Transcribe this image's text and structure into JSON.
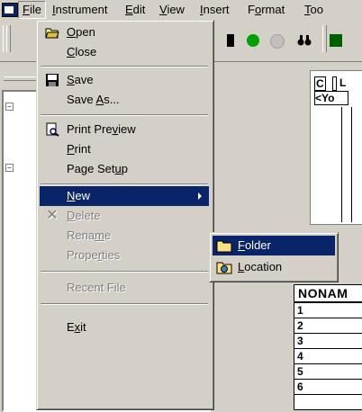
{
  "menubar": {
    "items": [
      {
        "label": "File",
        "key": "F",
        "rest": "ile"
      },
      {
        "label": "Instrument",
        "key": "I",
        "rest": "nstrument"
      },
      {
        "label": "Edit",
        "key": "E",
        "rest": "dit"
      },
      {
        "label": "View",
        "key": "V",
        "rest": "iew"
      },
      {
        "label": "Insert",
        "key": "I",
        "rest": "nsert"
      },
      {
        "label": "Format",
        "pre": "F",
        "key": "o",
        "rest": "rmat"
      },
      {
        "label": "Too",
        "key": "T",
        "rest": "oo"
      }
    ]
  },
  "file_menu": {
    "open": {
      "key": "O",
      "rest": "pen"
    },
    "close": {
      "key": "C",
      "rest": "lose"
    },
    "save": {
      "key": "S",
      "rest": "ave"
    },
    "save_as": {
      "pre": "Save ",
      "key": "A",
      "rest": "s..."
    },
    "print_preview": {
      "pre": "Print Pre",
      "key": "v",
      "rest": "iew"
    },
    "print": {
      "key": "P",
      "rest": "rint"
    },
    "page_setup": {
      "pre": "Page Set",
      "key": "u",
      "rest": "p"
    },
    "new": {
      "key": "N",
      "rest": "ew"
    },
    "delete": {
      "key": "D",
      "rest": "elete"
    },
    "rename": {
      "pre": "Rena",
      "key": "m",
      "rest": "e"
    },
    "properties": {
      "pre": "Prope",
      "key": "r",
      "rest": "ties"
    },
    "recent_file": "Recent File",
    "exit": {
      "pre": "E",
      "key": "x",
      "rest": "it"
    }
  },
  "new_submenu": {
    "folder": {
      "key": "F",
      "rest": "older"
    },
    "location": {
      "key": "L",
      "rest": "ocation"
    }
  },
  "right_pane": {
    "top_text_1": "C",
    "top_text_2": "L",
    "top_text_3": "<Yo",
    "grid_header": "NONAM",
    "grid_rows": [
      "1",
      "2",
      "3",
      "4",
      "5",
      "6"
    ]
  },
  "colors": {
    "menu_bg": "#d4d0c8",
    "highlight": "#0a246a",
    "disabled_text": "#808080"
  },
  "icons": [
    "app-system-icon",
    "open-folder-icon",
    "floppy-disk-icon",
    "print-preview-icon",
    "delete-x-icon",
    "folder-icon",
    "location-icon",
    "binoculars-icon",
    "green-circle-icon",
    "stop-icon"
  ]
}
